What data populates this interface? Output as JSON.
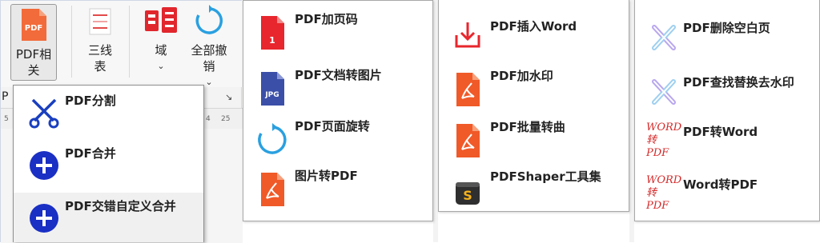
{
  "ribbon": {
    "pdf_button_line1": "PDF相",
    "pdf_button_line2": "关",
    "align_button_line1": "三线",
    "align_button_line2": "表",
    "field_button": "域",
    "undo_all_line1": "全部撤",
    "undo_all_line2": "销",
    "chevron": "⌄",
    "ruler_ticks": [
      "5",
      "4",
      "25"
    ],
    "side_letter": "P"
  },
  "menu": {
    "items": [
      {
        "label": "PDF分割",
        "icon": "scissors-icon"
      },
      {
        "label": "PDF合并",
        "icon": "plus-circle-icon"
      },
      {
        "label": "PDF交错自定义合并",
        "icon": "plus-circle-icon"
      }
    ]
  },
  "panel1": {
    "items": [
      {
        "label": "PDF加页码",
        "icon": "pdf-page-number-icon",
        "badge": "1"
      },
      {
        "label": "PDF文档转图片",
        "icon": "jpg-file-icon",
        "badge": "JPG"
      },
      {
        "label": "PDF页面旋转",
        "icon": "rotate-icon"
      },
      {
        "label": "图片转PDF",
        "icon": "pdf-file-icon"
      }
    ]
  },
  "panel2": {
    "items": [
      {
        "label": "PDF插入Word",
        "icon": "insert-download-icon"
      },
      {
        "label": "PDF加水印",
        "icon": "pdf-file-icon"
      },
      {
        "label": "PDF批量转曲",
        "icon": "pdf-file-icon"
      },
      {
        "label": "PDFShaper工具集",
        "icon": "pdfshaper-app-icon"
      }
    ]
  },
  "panel3": {
    "items": [
      {
        "label": "PDF删除空白页",
        "icon": "cross-delete-icon"
      },
      {
        "label": "PDF查找替换去水印",
        "icon": "cross-delete-icon"
      },
      {
        "label": "PDF转Word",
        "icon": "word-to-pdf-icon",
        "icon_text1": "WORD",
        "icon_text2": "转PDF"
      },
      {
        "label": "Word转PDF",
        "icon": "word-to-pdf-icon",
        "icon_text1": "WORD",
        "icon_text2": "转PDF"
      }
    ]
  },
  "colors": {
    "pdf_red": "#e8412c",
    "menu_blue": "#1a3fbf",
    "rotate_blue": "#2aa0e0"
  }
}
